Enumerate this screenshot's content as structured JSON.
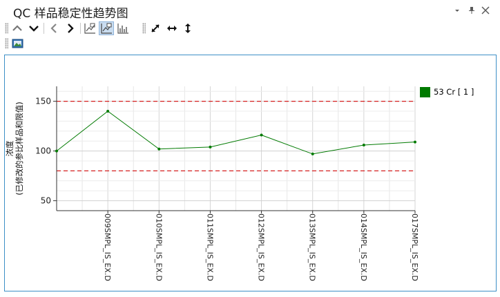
{
  "window": {
    "title": "QC 样品稳定性趋势图"
  },
  "icons": {
    "window_controls": [
      "dropdown-icon",
      "pin-icon",
      "close-icon"
    ],
    "toolbar": [
      "chevron-up-icon",
      "chevron-down-icon",
      "arrow-left-icon",
      "arrow-right-icon",
      "line-chart-icon",
      "line-chart-point-icon",
      "bar-chart-icon",
      "expand-diagonal-icon",
      "expand-horizontal-icon",
      "expand-vertical-icon",
      "export-image-icon"
    ]
  },
  "colors": {
    "series": "#007a00",
    "limit_line": "#d62020",
    "panel_border": "#3c8fc6",
    "active_button": "#c9dcf0"
  },
  "chart_data": {
    "type": "line",
    "ylabel": "浓度\n(已修改的参比样品和限值)",
    "ylim": [
      40,
      165
    ],
    "yticks": [
      50,
      100,
      150
    ],
    "grid": true,
    "legend_position": "right",
    "x_labels": [
      "009SMPL_IS_EX.D",
      "010SMPL_IS_EX.D",
      "011SMPL_IS_EX.D",
      "012SMPL_IS_EX.D",
      "013SMPL_IS_EX.D",
      "014SMPL_IS_EX.D",
      "017SMPL_IS_EX.D"
    ],
    "series": [
      {
        "name": "53 Cr [ 1 ]",
        "values": [
          100,
          140,
          102,
          104,
          116,
          97,
          106,
          109
        ]
      }
    ],
    "upper_limit": 150,
    "lower_limit": 80
  }
}
